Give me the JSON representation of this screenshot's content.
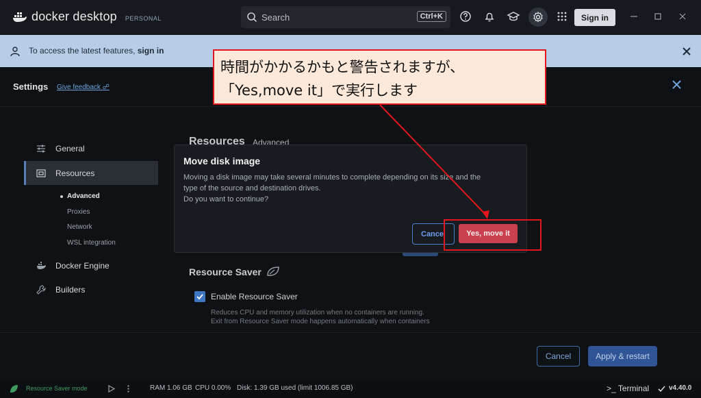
{
  "app": {
    "brand_name": "docker desktop",
    "plan": "PERSONAL",
    "search_placeholder": "Search",
    "search_shortcut": "Ctrl+K",
    "signin_label": "Sign in"
  },
  "banner": {
    "text": "To access the latest features, ",
    "link": "sign in"
  },
  "settings": {
    "title": "Settings",
    "feedback_link": "Give feedback"
  },
  "sidebar": {
    "items": [
      {
        "label": "General",
        "icon": "sliders-icon"
      },
      {
        "label": "Resources",
        "icon": "resources-icon"
      },
      {
        "label": "Docker Engine",
        "icon": "whale-icon"
      },
      {
        "label": "Builders",
        "icon": "wrench-icon"
      }
    ],
    "subitems": [
      "Advanced",
      "Proxies",
      "Network",
      "WSL integration"
    ]
  },
  "main": {
    "title": "Resources",
    "subtab": "Advanced",
    "resource_saver_title": "Resource Saver",
    "checkbox_label": "Enable Resource Saver",
    "checkbox_checked": true,
    "desc_line1": "Reduces CPU and memory utilization when no containers are running.",
    "desc_line2": "Exit from Resource Saver mode happens automatically when containers"
  },
  "footer": {
    "cancel_label": "Cancel",
    "apply_label": "Apply & restart"
  },
  "statusbar": {
    "mode": "Resource Saver mode",
    "ram": "RAM 1.06 GB",
    "cpu": "CPU 0.00%",
    "disk": "Disk: 1.39 GB used (limit 1006.85 GB)",
    "terminal": "Terminal",
    "version": "v4.40.0"
  },
  "modal": {
    "title": "Move disk image",
    "line1": "Moving a disk image may take several minutes to complete depending on its size and the",
    "line2": "type of the source and destination drives.",
    "line3": "Do you want to continue?",
    "cancel_label": "Cance",
    "confirm_label": "Yes, move it"
  },
  "annotation": {
    "line1": "時間がかかるかもと警告されますが、",
    "line2": "「Yes,move it」で実行します"
  },
  "colors": {
    "accent": "#3f77c4",
    "danger": "#c9414f",
    "banner_bg": "#b7cde5",
    "annotation_border": "#e2161c",
    "annotation_fill": "#fde9d9"
  }
}
